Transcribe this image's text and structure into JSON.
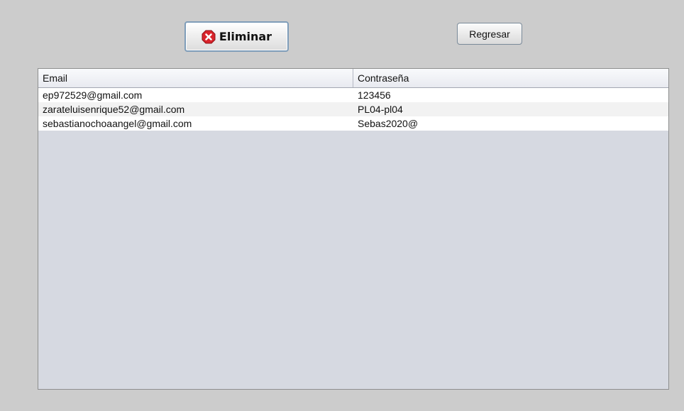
{
  "toolbar": {
    "delete_label": "Eliminar",
    "delete_icon": "delete-x-icon",
    "back_label": "Regresar"
  },
  "table": {
    "columns": [
      "Email",
      "Contraseña"
    ],
    "rows": [
      {
        "email": "ep972529@gmail.com",
        "password": "123456"
      },
      {
        "email": "zarateluisenrique52@gmail.com",
        "password": "PL04-pl04"
      },
      {
        "email": "sebastianochoaangel@gmail.com",
        "password": "Sebas2020@"
      }
    ]
  },
  "colors": {
    "background": "#cccccc",
    "table_empty_area": "#d6d9e1",
    "delete_icon": "#d9242b"
  }
}
